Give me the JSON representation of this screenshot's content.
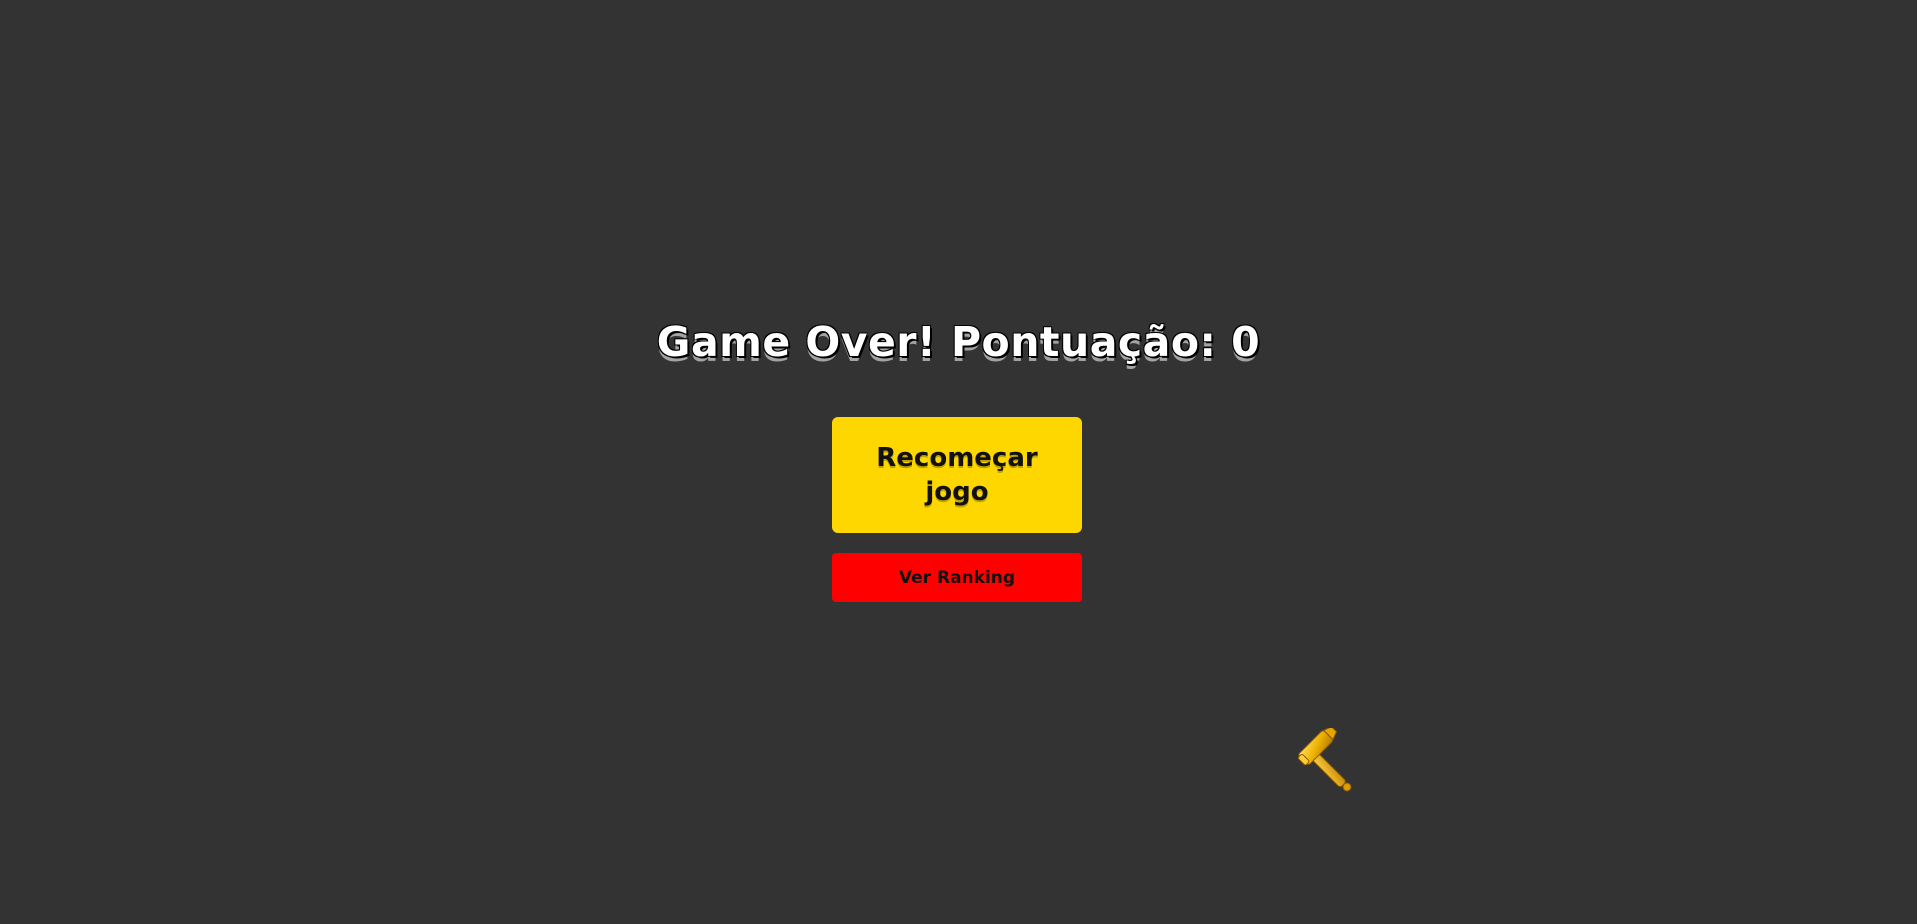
{
  "game_over": {
    "title": "Game Over! Pontuação: 0"
  },
  "buttons": {
    "restart_label": "Recomeçar jogo",
    "ranking_label": "Ver Ranking"
  },
  "cursor": {
    "icon": "hammer-icon"
  },
  "colors": {
    "background": "#333333",
    "restart_button": "#ffd700",
    "ranking_button": "#ff0000",
    "title_text": "#ffffff"
  }
}
